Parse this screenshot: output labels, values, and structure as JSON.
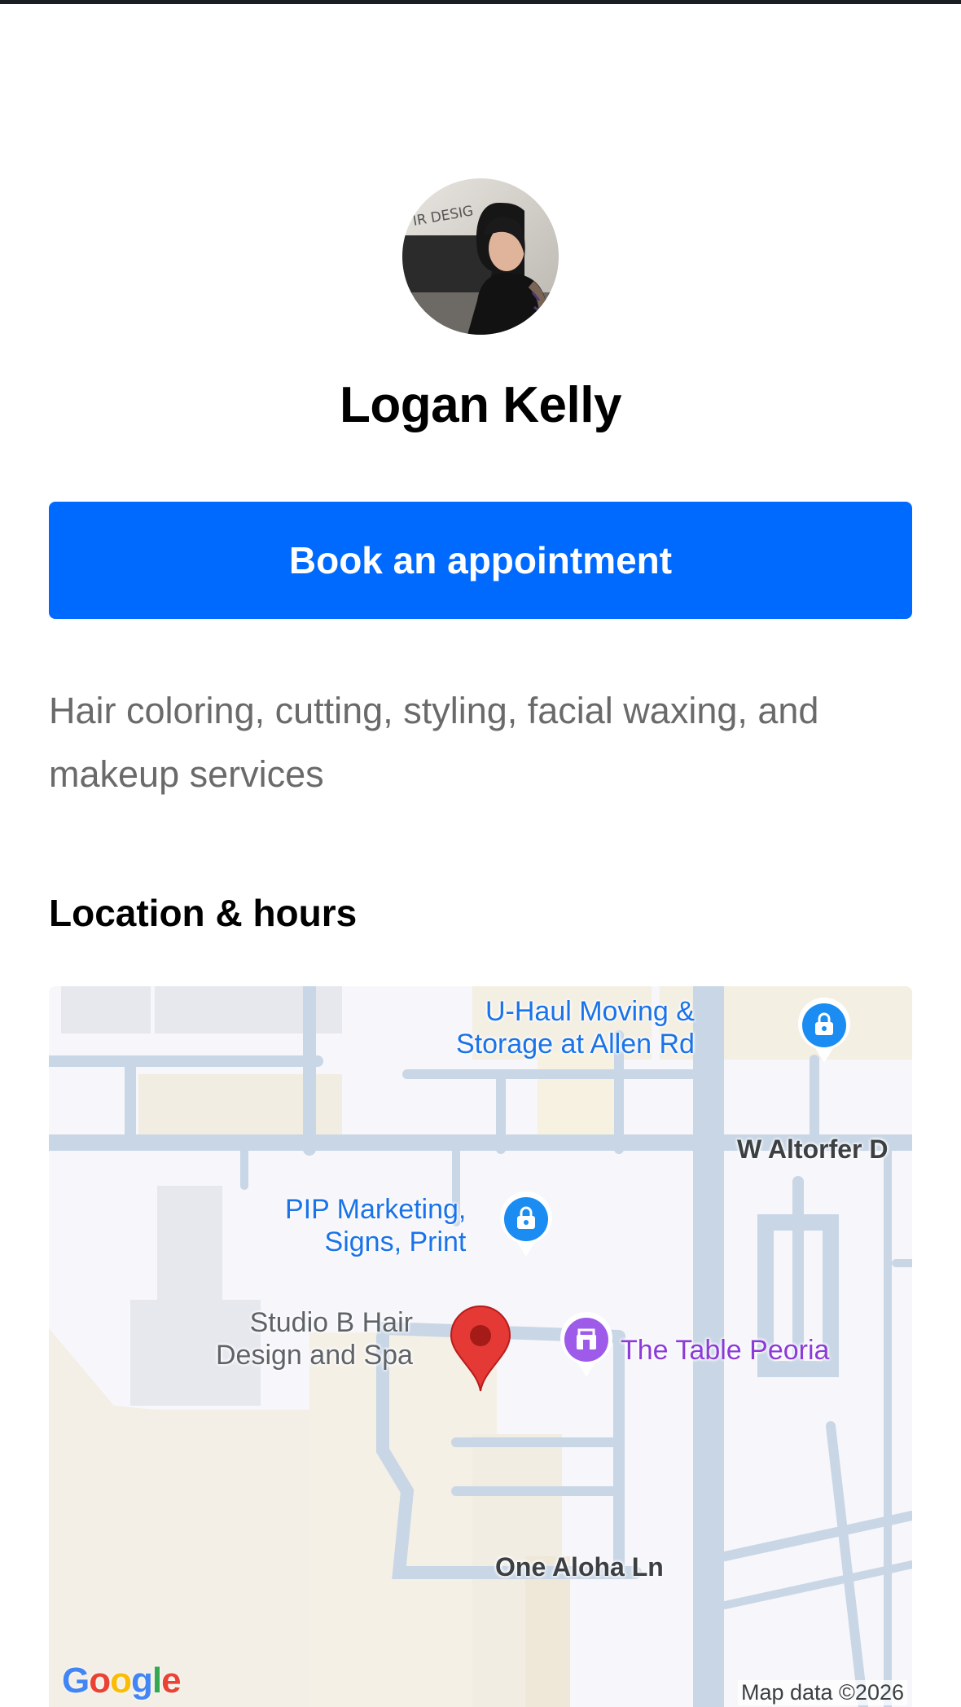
{
  "profile": {
    "name": "Logan Kelly",
    "avatar_text": "IR DESIG"
  },
  "actions": {
    "book_label": "Book an appointment"
  },
  "about": {
    "description": "Hair coloring, cutting, styling, facial waxing, and makeup services"
  },
  "location": {
    "section_title": "Location & hours",
    "map": {
      "places": [
        {
          "label": "U-Haul Moving &\nStorage at Allen Rd",
          "icon": "shopping-bag-pin-icon"
        },
        {
          "label": "PIP Marketing,\nSigns, Print",
          "icon": "shopping-bag-pin-icon"
        },
        {
          "label": "Studio B Hair\nDesign and Spa",
          "icon": "red-location-pin-icon"
        },
        {
          "label": "The Table Peoria",
          "icon": "purple-shop-pin-icon"
        }
      ],
      "streets": [
        "W Altorfer D",
        "One Aloha Ln"
      ],
      "logo": "Google",
      "attribution": "Map data ©2026"
    }
  },
  "colors": {
    "accent": "#006aff",
    "topbar": "#1b1e20",
    "description_text": "#6a6a6a"
  }
}
